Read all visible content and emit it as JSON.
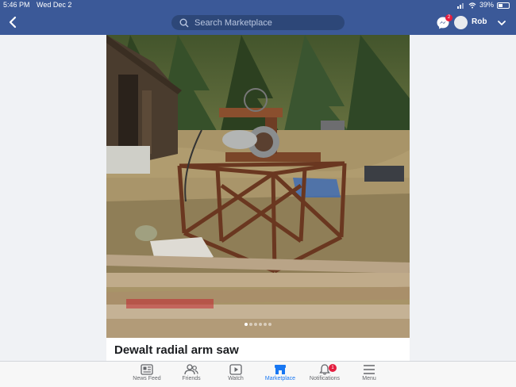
{
  "status_bar": {
    "time": "5:46 PM",
    "date": "Wed Dec 2",
    "battery": "39%"
  },
  "header": {
    "search_placeholder": "Search Marketplace",
    "user_name": "Rob",
    "messenger_badge": "2"
  },
  "listing": {
    "title": "Dewalt radial arm saw",
    "photo_count": 6,
    "active_photo": 1
  },
  "tabs": [
    {
      "label": "News Feed",
      "icon": "news-feed-icon"
    },
    {
      "label": "Friends",
      "icon": "friends-icon"
    },
    {
      "label": "Watch",
      "icon": "watch-icon"
    },
    {
      "label": "Marketplace",
      "icon": "marketplace-icon",
      "active": true
    },
    {
      "label": "Notifications",
      "icon": "bell-icon",
      "badge": "1"
    },
    {
      "label": "Menu",
      "icon": "hamburger-icon"
    }
  ],
  "colors": {
    "brand": "#3b5998",
    "active_tab": "#1877f2",
    "badge": "#e41e3f"
  }
}
